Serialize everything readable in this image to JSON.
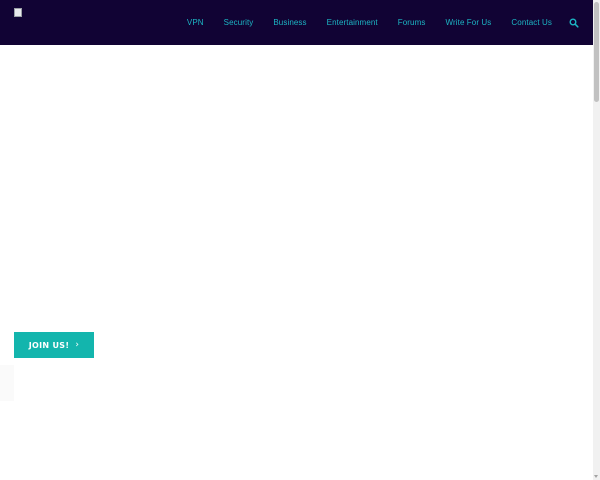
{
  "header": {
    "logo_alt": "",
    "nav_items": [
      {
        "label": "VPN"
      },
      {
        "label": "Security"
      },
      {
        "label": "Business"
      },
      {
        "label": "Entertainment"
      },
      {
        "label": "Forums"
      },
      {
        "label": "Write For Us"
      },
      {
        "label": "Contact Us"
      }
    ],
    "search_icon": "search-icon"
  },
  "hero": {
    "cta_label": "JOIN US!",
    "cta_icon": "chevron-right-icon",
    "cta_chevron": "›"
  },
  "colors": {
    "header_bg": "#110334",
    "nav_text": "#1cb6c4",
    "cta_bg": "#13b5ad",
    "cta_text": "#ffffff"
  }
}
